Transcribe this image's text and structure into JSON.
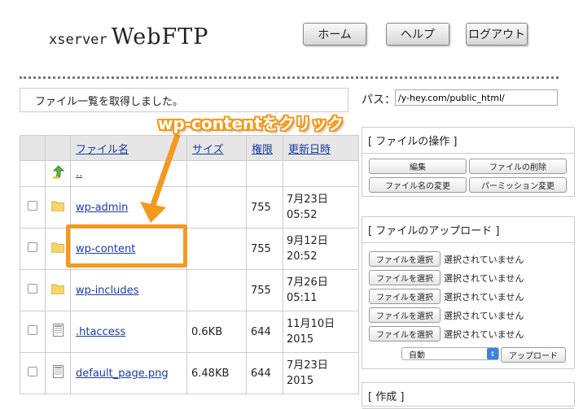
{
  "header": {
    "logo_small": "xserver",
    "logo_big": "WebFTP",
    "buttons": {
      "home": "ホーム",
      "help": "ヘルプ",
      "logout": "ログアウト"
    }
  },
  "status_message": "ファイル一覧を取得しました。",
  "path": {
    "label": "パス：",
    "value": "/y-hey.com/public_html/"
  },
  "table": {
    "headers": {
      "name": "ファイル名",
      "size": "サイズ",
      "perm": "権限",
      "date": "更新日時"
    },
    "parent": "..",
    "rows": [
      {
        "icon": "folder-icon",
        "name": "wp-admin",
        "size": "",
        "perm": "755",
        "date1": "7月23日",
        "date2": "05:52"
      },
      {
        "icon": "folder-icon",
        "name": "wp-content",
        "size": "",
        "perm": "755",
        "date1": "9月12日",
        "date2": "20:52"
      },
      {
        "icon": "folder-icon",
        "name": "wp-includes",
        "size": "",
        "perm": "755",
        "date1": "7月26日",
        "date2": "05:11"
      },
      {
        "icon": "document-icon",
        "name": ".htaccess",
        "size": "0.6KB",
        "perm": "644",
        "date1": "11月10日",
        "date2": "2015"
      },
      {
        "icon": "document-icon",
        "name": "default_page.png",
        "size": "6.48KB",
        "perm": "644",
        "date1": "7月23日",
        "date2": "2015"
      }
    ]
  },
  "file_ops": {
    "title": "[ ファイルの操作 ]",
    "edit": "編集",
    "delete": "ファイルの削除",
    "rename": "ファイル名の変更",
    "permission": "パーミッション変更"
  },
  "upload": {
    "title": "[ ファイルのアップロード ]",
    "choose": "ファイルを選択",
    "no_file": "選択されていません",
    "mode": "自動",
    "upload_button": "アップロード"
  },
  "create": {
    "title": "[ 作成 ]"
  },
  "annotation": {
    "text": "wp-contentをクリック"
  },
  "colors": {
    "accent": "#f29a1f",
    "link": "#1a3c9e"
  }
}
